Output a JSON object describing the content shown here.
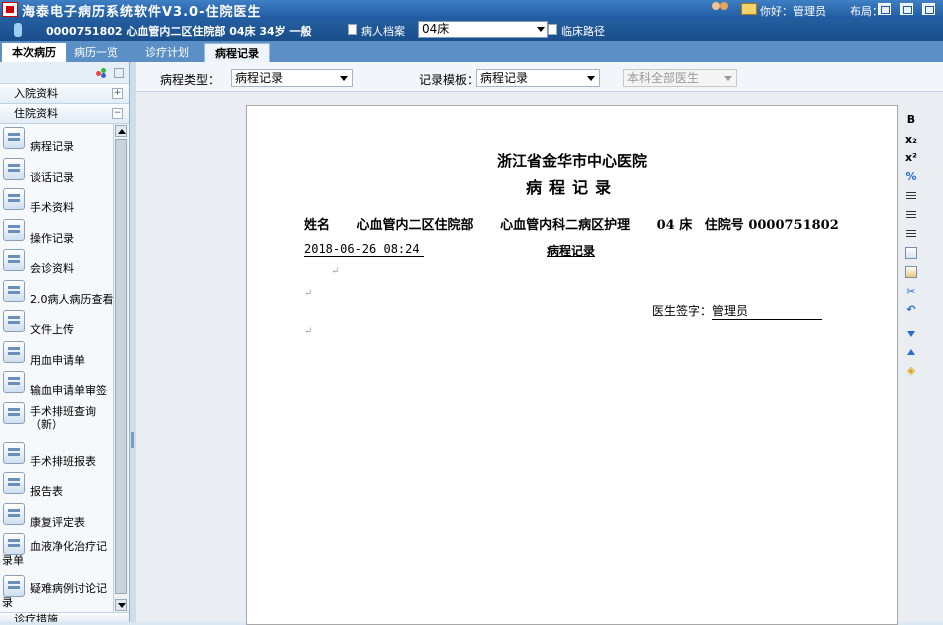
{
  "app": {
    "title": "海泰电子病历系统软件V3.0-住院医生",
    "greeting": "你好：管理员",
    "layout_label": "布局："
  },
  "patient_bar": {
    "info": "0000751802  心血管内二区住院部  04床  34岁  一般",
    "record_link": "病人档案",
    "bed_select": "04床",
    "pathway_link": "临床路径"
  },
  "tabs": [
    {
      "label": "本次病历"
    },
    {
      "label": "病历一览"
    },
    {
      "label": "诊疗计划"
    },
    {
      "label": "病程记录"
    }
  ],
  "sidebar": {
    "group_admission": "入院资料",
    "group_inpatient": "住院资料",
    "items": [
      {
        "label": "病程记录"
      },
      {
        "label": "谈话记录"
      },
      {
        "label": "手术资料"
      },
      {
        "label": "操作记录"
      },
      {
        "label": "会诊资料"
      },
      {
        "label": "2.0病人病历查看"
      },
      {
        "label": "文件上传"
      },
      {
        "label": "用血申请单"
      },
      {
        "label": "输血申请单审签"
      },
      {
        "label": "手术排班查询（新）"
      },
      {
        "label": "手术排班报表"
      },
      {
        "label": "报告表"
      },
      {
        "label": "康复评定表"
      },
      {
        "label": "血液净化治疗记录单"
      },
      {
        "label": "疑难病例讨论记录"
      }
    ],
    "group_bottom": "诊疗措施"
  },
  "filters": {
    "type_label": "病程类型：",
    "type_value": "病程记录",
    "template_label": "记录模板：",
    "template_value": "病程记录",
    "doctor_value": "本科全部医生"
  },
  "document": {
    "hospital": "浙江省金华市中心医院",
    "title": "病程记录",
    "name_label": "姓名",
    "ward": "心血管内二区住院部",
    "dept": "心血管内科二病区护理",
    "bed": "04 床",
    "admission_no": "住院号 0000751802",
    "datetime": "2018-06-26 08:24",
    "record_type": "病程记录",
    "signature_label": "医生签字：",
    "signature_name": "管理员"
  },
  "toolbar_right": [
    "bold-icon",
    "subscript-icon",
    "superscript-icon",
    "percent-icon",
    "align-left-icon",
    "align-center-icon",
    "align-right-icon",
    "copy-icon",
    "paste-icon",
    "cut-icon",
    "undo-icon",
    "move-down-icon",
    "move-up-icon",
    "fill-icon"
  ]
}
